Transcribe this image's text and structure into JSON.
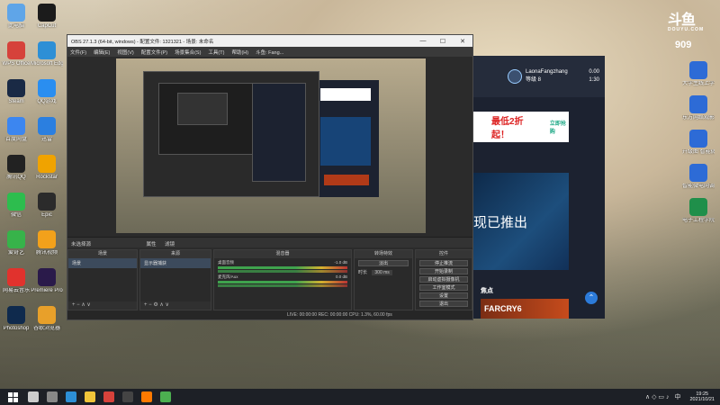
{
  "desktop": {
    "left_icons": [
      {
        "label": "此电脑",
        "color": "#5fa5e8"
      },
      {
        "label": "CapCut",
        "color": "#1b1b1b"
      },
      {
        "label": "WPS Office",
        "color": "#d6423b"
      },
      {
        "label": "Microsoft Edge",
        "color": "#2d8fd6"
      },
      {
        "label": "Steam",
        "color": "#1a2a45"
      },
      {
        "label": "QQ游戏",
        "color": "#2a8ef0"
      },
      {
        "label": "百度网盘",
        "color": "#3c86f0"
      },
      {
        "label": "迅雷",
        "color": "#2b7fe0"
      },
      {
        "label": "腾讯QQ",
        "color": "#222"
      },
      {
        "label": "Rockstar",
        "color": "#f0a300"
      },
      {
        "label": "微信",
        "color": "#2dbd4e"
      },
      {
        "label": "Epic",
        "color": "#2b2b2b"
      },
      {
        "label": "爱奇艺",
        "color": "#37b34a"
      },
      {
        "label": "腾讯视频",
        "color": "#f2a11b"
      },
      {
        "label": "网易云音乐",
        "color": "#e1322d"
      },
      {
        "label": "Premiere Pro",
        "color": "#2a1a4a"
      },
      {
        "label": "Photoshop",
        "color": "#0f2a4d"
      },
      {
        "label": "谷歌浏览器",
        "color": "#e8a02a"
      }
    ],
    "right_icons": [
      {
        "label": "大学生线上学习效果研究",
        "color": "#2d6bd6"
      },
      {
        "label": "东方网络观影量调查问卷.docx",
        "color": "#2d6bd6"
      },
      {
        "label": "升级图 智能微电网系统.docx",
        "color": "#2d6bd6"
      },
      {
        "label": "智能微电网调度优化研究.docx",
        "color": "#2d6bd6"
      },
      {
        "label": "电子工程学院学生成绩表.xls",
        "color": "#1f8f4a"
      }
    ],
    "brand_logo": "斗鱼",
    "brand_sub": "DOUYU.COM",
    "viewer_count": "909"
  },
  "obs": {
    "title": "OBS 27.1.3 (64-bit, windows) - 配置文件: 1321321 - 场景: 未命名",
    "menu": [
      "文件(F)",
      "编辑(E)",
      "视图(V)",
      "配置文件(P)",
      "场景集合(S)",
      "工具(T)",
      "帮助(H)",
      "斗鱼: Fang..."
    ],
    "window_buttons": [
      "—",
      "☐",
      "✕"
    ],
    "scene_bar": "未选择源",
    "scene_bar_props": "属性",
    "scene_bar_filters": "滤镜",
    "docks": {
      "scenes": {
        "title": "场景",
        "items": [
          "场景"
        ]
      },
      "sources": {
        "title": "来源",
        "items": [
          "显示器捕获"
        ]
      },
      "mixer": {
        "title": "混音器",
        "channels": [
          {
            "name": "桌面音频",
            "db": "-1.0 dB"
          },
          {
            "name": "麦克风/Aux",
            "db": "0.0 dB"
          }
        ]
      },
      "transitions": {
        "title": "转场特效",
        "type": "淡出",
        "duration_label": "时长",
        "duration": "300 ms"
      },
      "controls": {
        "title": "控件",
        "buttons": [
          "停止推流",
          "开始录制",
          "启动虚拟摄像机",
          "工作室模式",
          "设置",
          "退出"
        ]
      }
    },
    "status": "LIVE: 00:00:00   REC: 00:00:00   CPU: 1.3%, 60.00 fps"
  },
  "douyu_panel": {
    "username": "LaonaFangzhang",
    "level": "等级 8",
    "stat_a": "0.00",
    "stat_b": "1:30",
    "banner": "最低2折起！",
    "banner_sub": "立即抢购",
    "hero_text": "现已推出",
    "section": "焦点",
    "game_title": "FARCRY6"
  },
  "taskbar": {
    "apps": [
      {
        "name": "search",
        "color": "#cccccc"
      },
      {
        "name": "task-view",
        "color": "#888888"
      },
      {
        "name": "edge",
        "color": "#2d8fd6"
      },
      {
        "name": "explorer",
        "color": "#f0c53a"
      },
      {
        "name": "wps",
        "color": "#d6423b"
      },
      {
        "name": "obs",
        "color": "#444444"
      },
      {
        "name": "douyu",
        "color": "#ff7a00"
      },
      {
        "name": "chrome",
        "color": "#4caf50"
      }
    ],
    "time": "19:25",
    "date": "2021/10/21",
    "tray_lang": "中",
    "tray_icons": "∧ ◇ ▭ ♪"
  }
}
